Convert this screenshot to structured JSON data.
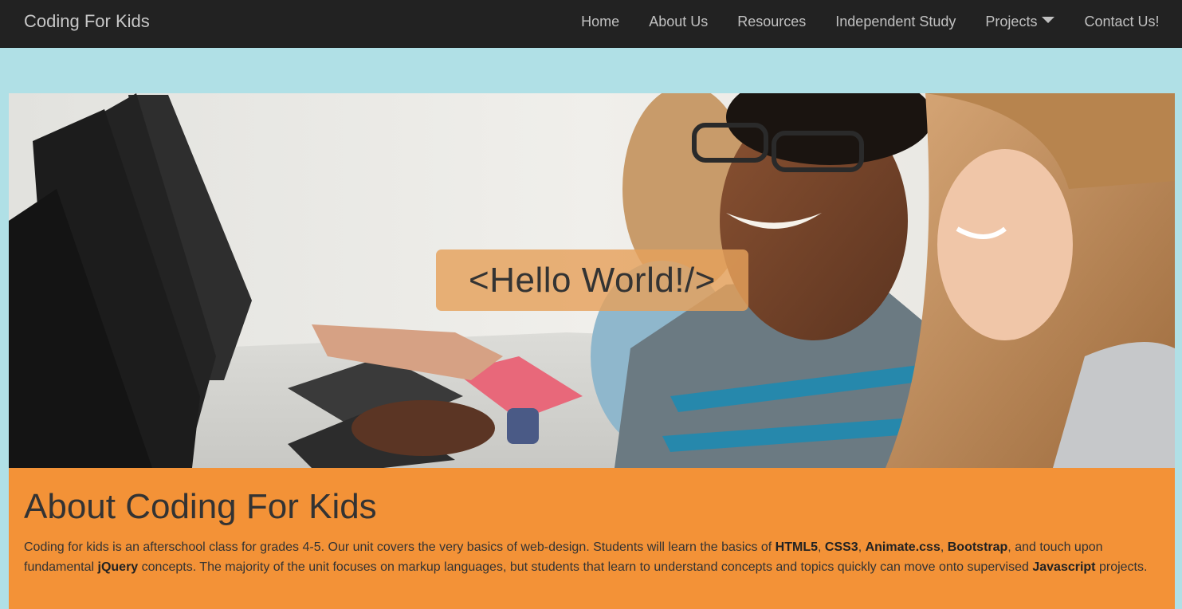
{
  "navbar": {
    "brand": "Coding For Kids",
    "items": [
      {
        "label": "Home"
      },
      {
        "label": "About Us"
      },
      {
        "label": "Resources"
      },
      {
        "label": "Independent Study"
      },
      {
        "label": "Projects"
      },
      {
        "label": "Contact Us!"
      }
    ]
  },
  "hero": {
    "banner_text": "<Hello World!/>",
    "image_alt": "Students smiling while coding at computers"
  },
  "about": {
    "heading": "About Coding For Kids",
    "paragraph": {
      "t1": "Coding for kids is an afterschool class for grades 4-5. Our unit covers the very basics of web-design. Students will learn the basics of ",
      "b1": "HTML5",
      "t2": ", ",
      "b2": "CSS3",
      "t3": ", ",
      "b3": "Animate.css",
      "t4": ", ",
      "b4": "Bootstrap",
      "t5": ", and touch upon fundamental ",
      "b5": "jQuery",
      "t6": " concepts. The majority of the unit focuses on markup languages, but students that learn to understand concepts and topics quickly can move onto supervised ",
      "b6": "Javascript",
      "t7": " projects."
    }
  },
  "colors": {
    "navbar_bg": "#222222",
    "page_bg": "#b0e0e6",
    "about_bg": "#f39237"
  }
}
